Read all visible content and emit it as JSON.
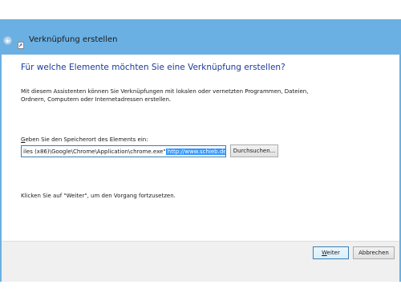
{
  "window": {
    "title": "Verknüpfung erstellen",
    "accent_color": "#6bb0e3",
    "icons": {
      "back": "back-arrow-icon",
      "app": "shortcut-icon"
    }
  },
  "main": {
    "heading": "Für welche Elemente möchten Sie eine Verknüpfung erstellen?",
    "description": "Mit diesem Assistenten können Sie Verknüpfungen mit lokalen oder vernetzten Programmen, Dateien, Ordnern, Computern oder Internetadressen erstellen.",
    "location_label_accesskey": "G",
    "location_label_rest": "eben Sie den Speicherort des Elements ein:",
    "location_value_plain": "iles (x86)\\Google\\Chrome\\Application\\chrome.exe\"",
    "location_value_selected": " http://www.schieb.de/",
    "browse_button": "Durchsuchen...",
    "hint": "Klicken Sie auf \"Weiter\", um den Vorgang fortzusetzen."
  },
  "footer": {
    "next_button_accesskey": "W",
    "next_button_rest": "eiter",
    "cancel_button": "Abbrechen"
  }
}
